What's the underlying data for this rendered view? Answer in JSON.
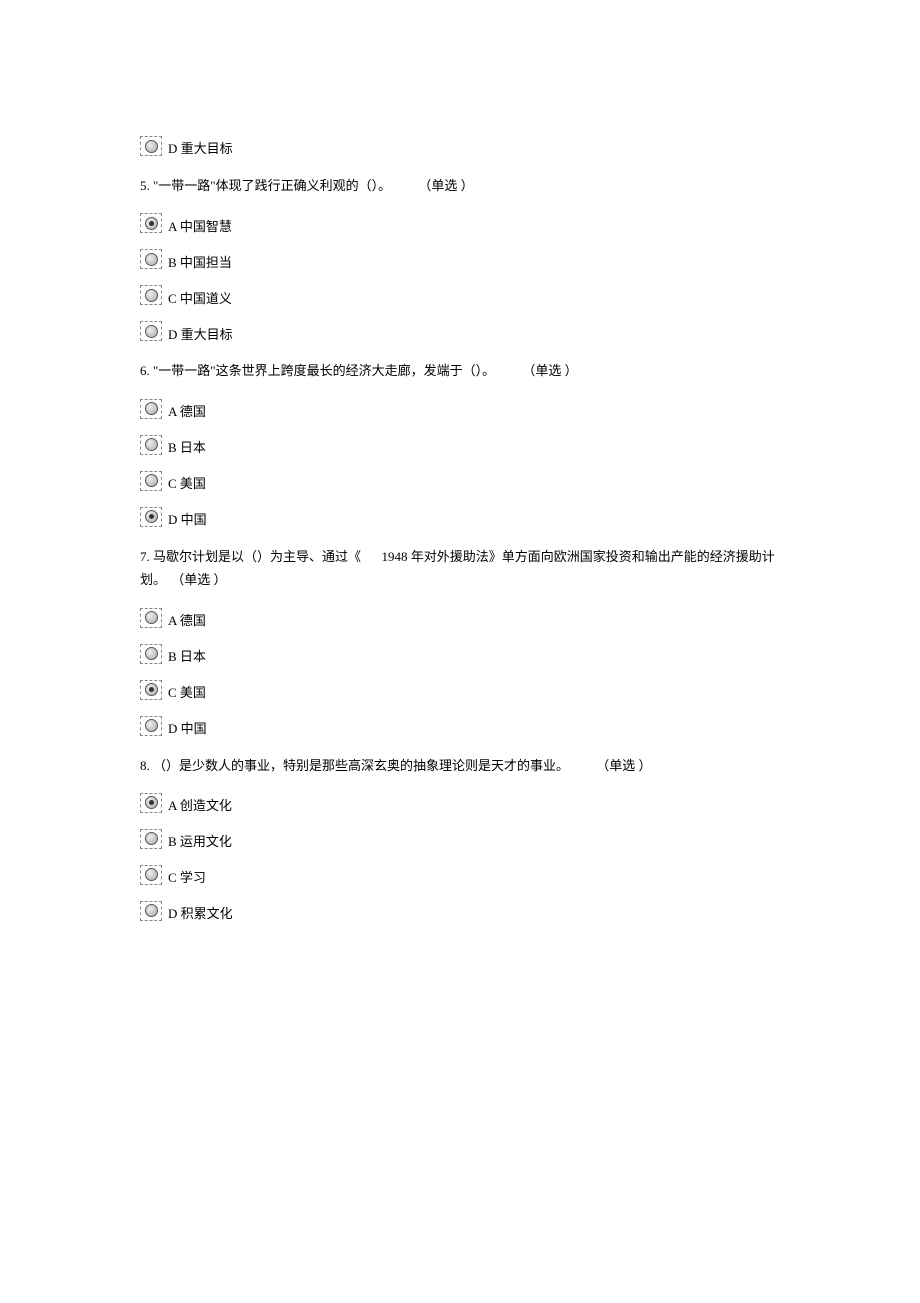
{
  "partial_option": {
    "letter": "D",
    "text": "重大目标"
  },
  "questions": [
    {
      "number": "5.",
      "text": "\"一带一路\"体现了践行正确义利观的（）。",
      "type": "（单选 ）",
      "options": [
        {
          "letter": "A",
          "text": "中国智慧",
          "selected": true
        },
        {
          "letter": "B",
          "text": "中国担当",
          "selected": false
        },
        {
          "letter": "C",
          "text": "中国道义",
          "selected": false
        },
        {
          "letter": "D",
          "text": "重大目标",
          "selected": false
        }
      ]
    },
    {
      "number": "6.",
      "text": "\"一带一路\"这条世界上跨度最长的经济大走廊，发端于（）。",
      "type": "（单选 ）",
      "options": [
        {
          "letter": "A",
          "text": "德国",
          "selected": false
        },
        {
          "letter": "B",
          "text": "日本",
          "selected": false
        },
        {
          "letter": "C",
          "text": "美国",
          "selected": false
        },
        {
          "letter": "D",
          "text": "中国",
          "selected": true
        }
      ]
    },
    {
      "number": "7.",
      "text_pre": "马歇尔计划是以（）为主导、通过《",
      "text_year": "1948",
      "text_post": "年对外援助法》单方面向欧洲国家投资和输出产能的经济援助计划。",
      "type": "（单选 ）",
      "options": [
        {
          "letter": "A",
          "text": "德国",
          "selected": false
        },
        {
          "letter": "B",
          "text": "日本",
          "selected": false
        },
        {
          "letter": "C",
          "text": "美国",
          "selected": true
        },
        {
          "letter": "D",
          "text": "中国",
          "selected": false
        }
      ]
    },
    {
      "number": "8.",
      "text": "（）是少数人的事业，特别是那些高深玄奥的抽象理论则是天才的事业。",
      "type": "（单选 ）",
      "options": [
        {
          "letter": "A",
          "text": "创造文化",
          "selected": true
        },
        {
          "letter": "B",
          "text": "运用文化",
          "selected": false
        },
        {
          "letter": "C",
          "text": "学习",
          "selected": false
        },
        {
          "letter": "D",
          "text": "积累文化",
          "selected": false
        }
      ]
    }
  ]
}
